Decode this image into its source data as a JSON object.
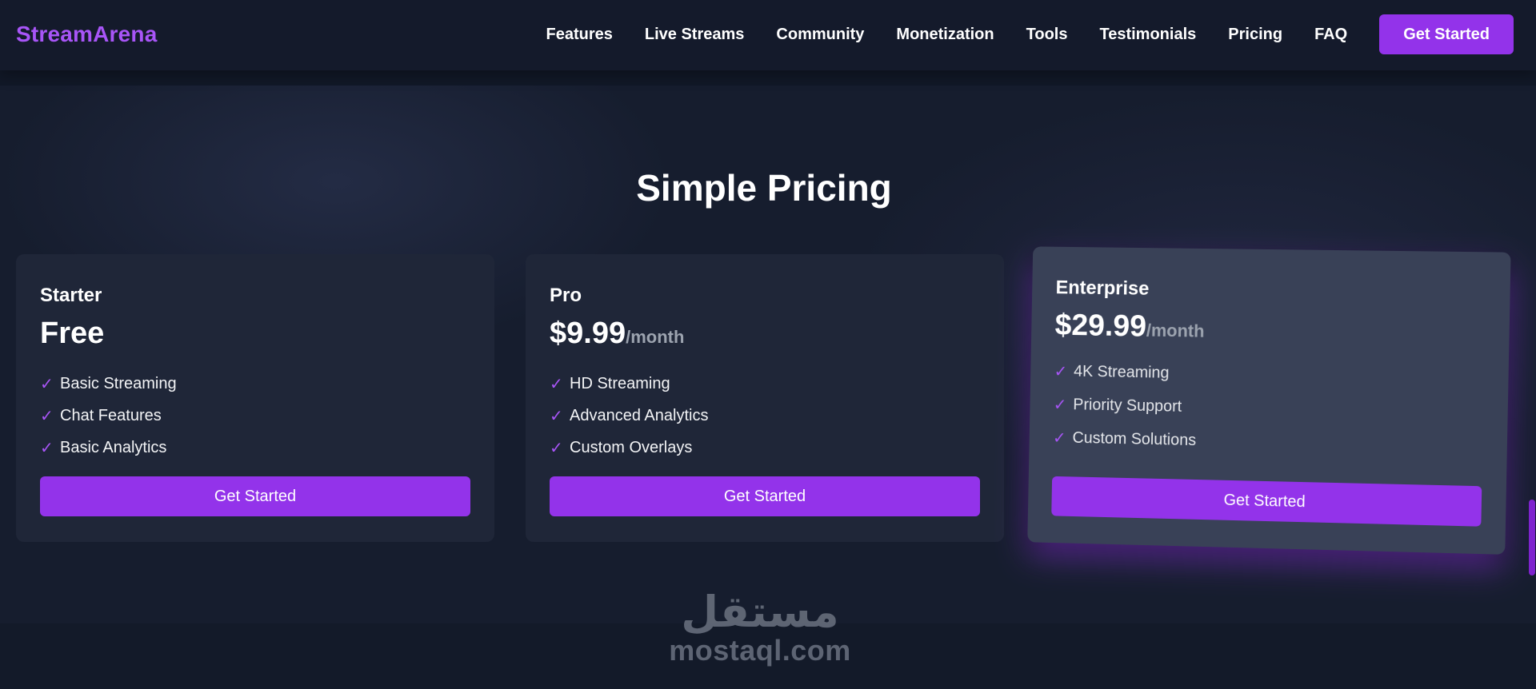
{
  "header": {
    "brand": "StreamArena",
    "nav": [
      "Features",
      "Live Streams",
      "Community",
      "Monetization",
      "Tools",
      "Testimonials",
      "Pricing",
      "FAQ"
    ],
    "cta_label": "Get Started"
  },
  "pricing": {
    "title": "Simple Pricing",
    "plans": [
      {
        "name": "Starter",
        "price": "Free",
        "period": "",
        "features": [
          "Basic Streaming",
          "Chat Features",
          "Basic Analytics"
        ],
        "button": "Get Started"
      },
      {
        "name": "Pro",
        "price": "$9.99",
        "period": "/month",
        "features": [
          "HD Streaming",
          "Advanced Analytics",
          "Custom Overlays"
        ],
        "button": "Get Started"
      },
      {
        "name": "Enterprise",
        "price": "$29.99",
        "period": "/month",
        "features": [
          "4K Streaming",
          "Priority Support",
          "Custom Solutions"
        ],
        "button": "Get Started"
      }
    ],
    "check_glyph": "✓"
  },
  "watermark": {
    "arabic": "مستقل",
    "latin": "mostaql.com"
  },
  "colors": {
    "accent": "#9333ea",
    "brand": "#a855f7",
    "background": "#161d2e",
    "card": "#1f2638",
    "card_highlight": "#394157"
  }
}
